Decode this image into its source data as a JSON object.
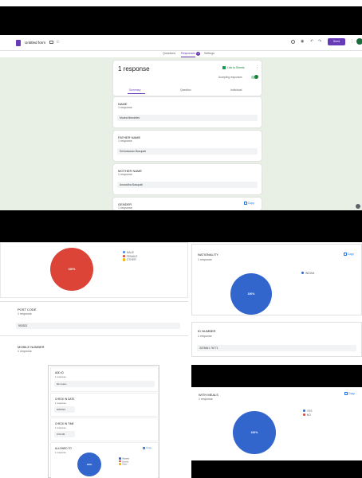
{
  "forms": {
    "title": "Untitled form",
    "tabs": [
      "Questions",
      "Responses",
      "Settings"
    ],
    "responses_badge": "1",
    "send_label": "Send",
    "response_count": "1 response",
    "link_sheets": "Link to Sheets",
    "accepting": "Accepting responses",
    "subtabs": [
      "Summary",
      "Question",
      "Individual"
    ],
    "cards": [
      {
        "label": "NAME",
        "count": "1 response",
        "answer": "Mudra Mendelev"
      },
      {
        "label": "FATHER NAME",
        "count": "1 response",
        "answer": "Srinivasarao Busupati"
      },
      {
        "label": "MOTHER NAME",
        "count": "1 response",
        "answer": "Anuradha Busupati"
      },
      {
        "label": "GENDER",
        "count": "1 response"
      }
    ],
    "copy_label": "Copy"
  },
  "gender_chart": {
    "percent": "100%",
    "legend": [
      "MALE",
      "FEMALE",
      "OTHER"
    ],
    "colors": [
      "#4285f4",
      "#db4437",
      "#f4b400"
    ]
  },
  "post_code": {
    "label": "POST CODE",
    "count": "1 response",
    "answer": "592522"
  },
  "mobile": {
    "label": "MOBILE NUMBER",
    "count": "1 response"
  },
  "nationality": {
    "label": "NATIONALITY",
    "count": "1 response",
    "legend": [
      "INDIAN"
    ],
    "percent": "100%",
    "copy": "Copy"
  },
  "id_number": {
    "label": "ID NUMBER",
    "count": "1 response",
    "answer": "3378461 76771"
  },
  "small": {
    "cards": [
      {
        "label": "ADD ID",
        "count": "1 response",
        "answer": "Mu Guam"
      },
      {
        "label": "CHECK IN DATE",
        "count": "1 response",
        "answer": "6/8/2023"
      },
      {
        "label": "CHECK IN TIME",
        "count": "1 response",
        "answer": "9:00 AM"
      },
      {
        "label": "ALLOWED TO",
        "count": "1 response",
        "copy": "Copy",
        "legend": [
          "Allowed",
          "Denied",
          "Other"
        ],
        "percent": "100%"
      }
    ]
  },
  "meals": {
    "label": "WITH MEALS",
    "count": "1 response",
    "legend": [
      "YES",
      "NO"
    ],
    "percent": "100%",
    "copy": "Copy"
  }
}
